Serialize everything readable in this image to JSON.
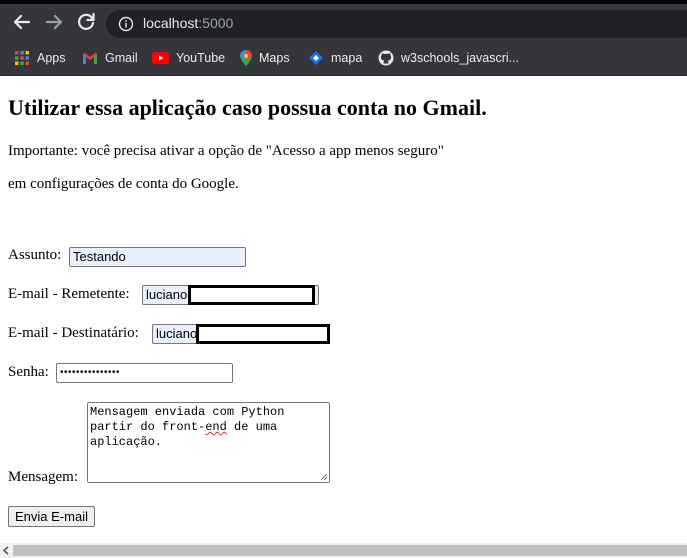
{
  "browser": {
    "url_host": "localhost",
    "url_port": ":5000"
  },
  "bookmarks": [
    {
      "label": "Apps",
      "icon": "apps-grid-icon"
    },
    {
      "label": "Gmail",
      "icon": "gmail-icon"
    },
    {
      "label": "YouTube",
      "icon": "youtube-icon"
    },
    {
      "label": "Maps",
      "icon": "maps-icon"
    },
    {
      "label": "mapa",
      "icon": "mapa-icon"
    },
    {
      "label": "w3schools_javascri...",
      "icon": "github-icon"
    }
  ],
  "page": {
    "heading": "Utilizar essa aplicação caso possua conta no Gmail.",
    "note_1": "Importante: você precisa ativar a opção de \"Acesso a app menos seguro\"",
    "note_2": "em configurações de conta do Google."
  },
  "form": {
    "subject_label": "Assunto:",
    "subject_value": "Testando",
    "sender_label": "E-mail - Remetente:",
    "sender_value": "luciano",
    "recipient_label": "E-mail - Destinatário:",
    "recipient_value": "luciano",
    "password_label": "Senha:",
    "password_value": "•••••••••••••••",
    "message_label": "Mensagem:",
    "message_line_1": "Mensagem enviada com Python",
    "message_line_2_a": "partir do front-",
    "message_line_2_b": "end",
    "message_line_2_c": " de uma",
    "message_line_3": "aplicação.",
    "submit_label": "Envia E-mail"
  },
  "colors": {
    "toolbar": "#35363a",
    "autofill": "#e8f0fe"
  }
}
